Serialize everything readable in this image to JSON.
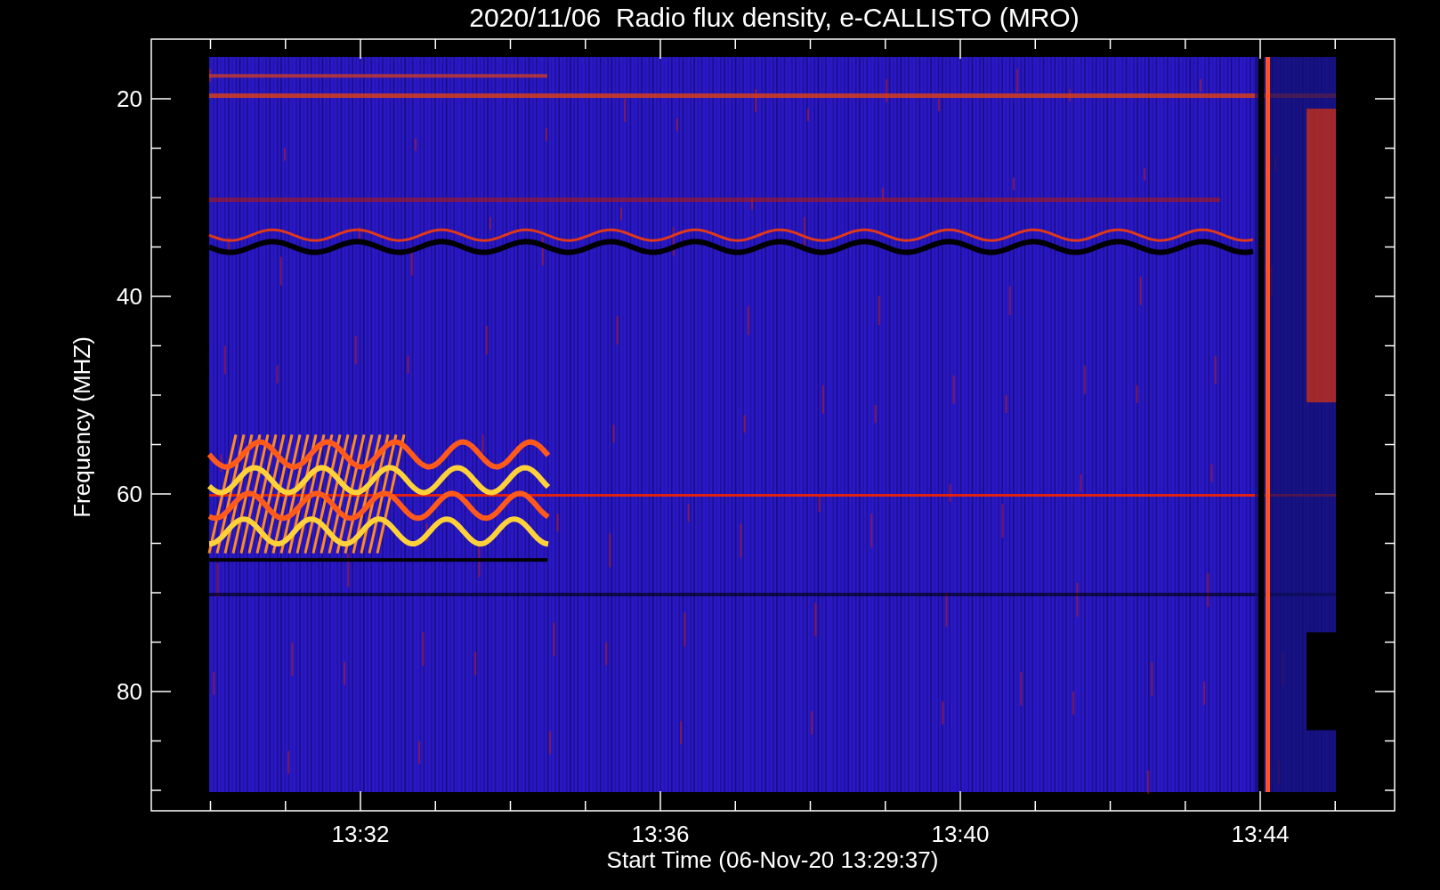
{
  "plot": {
    "title": "2020/11/06  Radio flux density, e-CALLISTO (MRO)",
    "ylabel": "Frequency (MHZ)",
    "xlabel": "Start Time (06-Nov-20 13:29:37)",
    "yticks": [
      "20",
      "40",
      "60",
      "80"
    ],
    "xticks": [
      "13:32",
      "13:36",
      "13:40",
      "13:44"
    ]
  }
}
